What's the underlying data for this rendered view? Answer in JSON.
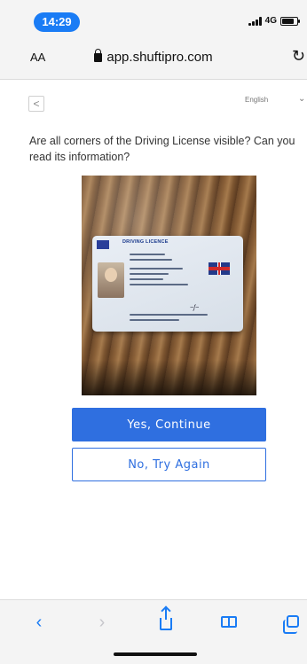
{
  "status_bar": {
    "time": "14:29",
    "network": "4G",
    "battery_level": 0.8
  },
  "browser": {
    "text_size_label": "AA",
    "url": "app.shuftipro.com",
    "toolbar": {
      "back": "back-chevron-icon",
      "forward": "forward-chevron-icon",
      "share": "share-icon",
      "bookmarks": "book-icon",
      "tabs": "tabs-icon"
    }
  },
  "page": {
    "back_label": "<",
    "language": "English",
    "question": "Are all corners of the Driving License visible? Can you read its information?",
    "document_title": "DRIVING LICENCE",
    "yes_button": "Yes, Continue",
    "no_button": "No, Try Again"
  },
  "colors": {
    "accent": "#2f6fe0",
    "ios_blue": "#1a7cf5"
  }
}
